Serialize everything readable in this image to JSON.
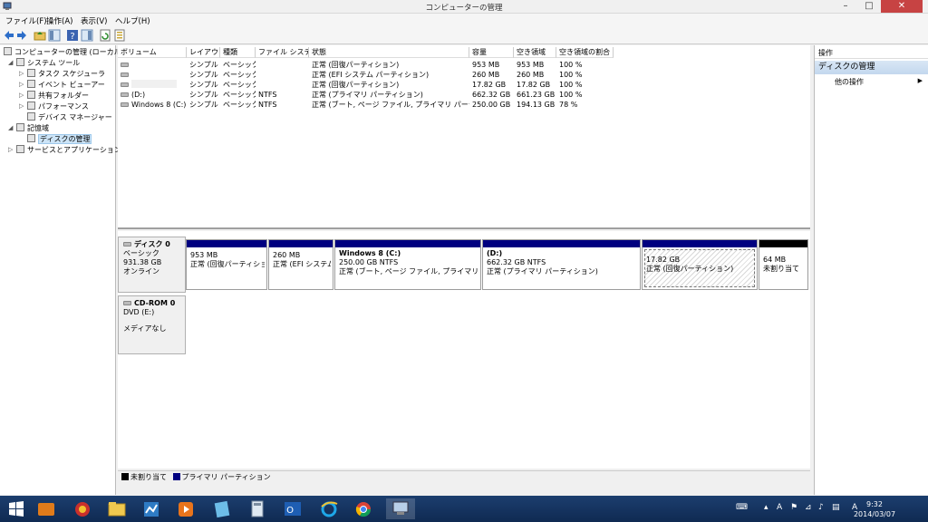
{
  "window": {
    "title": "コンピューターの管理"
  },
  "menu": [
    "ファイル(F)",
    "操作(A)",
    "表示(V)",
    "ヘルプ(H)"
  ],
  "tree": {
    "root": "コンピューターの管理 (ローカル)",
    "system_tools": "システム ツール",
    "task_scheduler": "タスク スケジューラ",
    "event_viewer": "イベント ビューアー",
    "shared_folders": "共有フォルダー",
    "performance": "パフォーマンス",
    "device_manager": "デバイス マネージャー",
    "storage": "記憶域",
    "disk_management": "ディスクの管理",
    "services_apps": "サービスとアプリケーション"
  },
  "columns": [
    "ボリューム",
    "レイアウト",
    "種類",
    "ファイル システム",
    "状態",
    "容量",
    "空き領域",
    "空き領域の割合"
  ],
  "volumes": [
    {
      "name": "",
      "layout": "シンプル",
      "type": "ベーシック",
      "fs": "",
      "status": "正常 (回復パーティション)",
      "capacity": "953 MB",
      "free": "953 MB",
      "pct": "100 %"
    },
    {
      "name": "",
      "layout": "シンプル",
      "type": "ベーシック",
      "fs": "",
      "status": "正常 (EFI システム パーティション)",
      "capacity": "260 MB",
      "free": "260 MB",
      "pct": "100 %"
    },
    {
      "name": "",
      "layout": "シンプル",
      "type": "ベーシック",
      "fs": "",
      "status": "正常 (回復パーティション)",
      "capacity": "17.82 GB",
      "free": "17.82 GB",
      "pct": "100 %"
    },
    {
      "name": "(D:)",
      "layout": "シンプル",
      "type": "ベーシック",
      "fs": "NTFS",
      "status": "正常 (プライマリ パーティション)",
      "capacity": "662.32 GB",
      "free": "661.23 GB",
      "pct": "100 %"
    },
    {
      "name": "Windows 8 (C:)",
      "layout": "シンプル",
      "type": "ベーシック",
      "fs": "NTFS",
      "status": "正常 (ブート, ページ ファイル, プライマリ パーティション)",
      "capacity": "250.00 GB",
      "free": "194.13 GB",
      "pct": "78 %"
    }
  ],
  "disk0": {
    "name": "ディスク 0",
    "type": "ベーシック",
    "size": "931.38 GB",
    "state": "オンライン",
    "partitions": [
      {
        "title": "",
        "size": "953 MB",
        "status": "正常 (回復パーティション)"
      },
      {
        "title": "",
        "size": "260 MB",
        "status": "正常 (EFI システム"
      },
      {
        "title": "Windows 8  (C:)",
        "size": "250.00 GB NTFS",
        "status": "正常 (ブート, ページ ファイル, プライマリ パーティ"
      },
      {
        "title": "(D:)",
        "size": "662.32 GB NTFS",
        "status": "正常 (プライマリ パーティション)"
      },
      {
        "title": "",
        "size": "17.82 GB",
        "status": "正常 (回復パーティション)"
      },
      {
        "title": "",
        "size": "64 MB",
        "status": "未割り当て"
      }
    ]
  },
  "cdrom0": {
    "name": "CD-ROM 0",
    "drive": "DVD (E:)",
    "media": "メディアなし"
  },
  "legend": {
    "unallocated": "未割り当て",
    "primary": "プライマリ パーティション"
  },
  "actions": {
    "header": "操作",
    "section": "ディスクの管理",
    "other": "他の操作"
  },
  "clock": {
    "time": "9:32",
    "date": "2014/03/07"
  },
  "colors": {
    "primary_partition": "#000080",
    "unallocated": "#000000",
    "selection": "#cce4f7",
    "taskbar": "#1c3e6e"
  }
}
